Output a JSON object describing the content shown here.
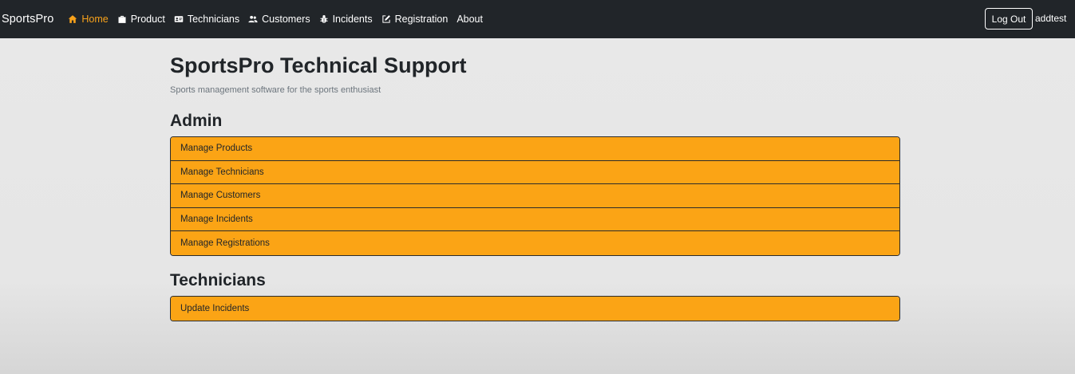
{
  "navbar": {
    "brand": "SportsPro",
    "items": [
      {
        "label": "Home",
        "icon": "home-icon",
        "active": true
      },
      {
        "label": "Product",
        "icon": "briefcase-icon",
        "active": false
      },
      {
        "label": "Technicians",
        "icon": "id-card-icon",
        "active": false
      },
      {
        "label": "Customers",
        "icon": "users-icon",
        "active": false
      },
      {
        "label": "Incidents",
        "icon": "bug-icon",
        "active": false
      },
      {
        "label": "Registration",
        "icon": "edit-icon",
        "active": false
      },
      {
        "label": "About",
        "icon": "",
        "active": false
      }
    ],
    "logout_label": "Log Out",
    "username": "addtest",
    "active_color": "#f8a21b"
  },
  "main": {
    "title": "SportsPro Technical Support",
    "subtitle": "Sports management software for the sports enthusiast",
    "admin": {
      "heading": "Admin",
      "items": [
        "Manage Products",
        "Manage Technicians",
        "Manage Customers",
        "Manage Incidents",
        "Manage Registrations"
      ]
    },
    "technicians": {
      "heading": "Technicians",
      "items": [
        "Update Incidents"
      ]
    },
    "accent_color": "#fba415"
  }
}
